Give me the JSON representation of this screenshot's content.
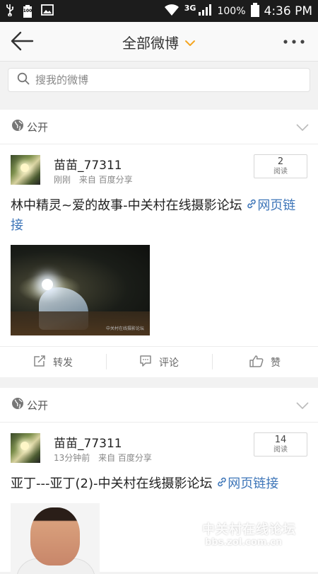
{
  "status_bar": {
    "battery_small": "100",
    "network": "3G",
    "battery_percent": "100%",
    "time": "4:36 PM",
    "icons": [
      "usb-icon",
      "battery-small-icon",
      "image-icon",
      "wifi-icon",
      "signal-icon",
      "battery-icon"
    ]
  },
  "nav": {
    "title": "全部微博",
    "back_icon": "back-arrow-icon",
    "dropdown_icon": "chevron-down-icon",
    "more_icon": "more-icon",
    "accent_color": "#f5a623"
  },
  "search": {
    "placeholder": "搜我的微博"
  },
  "posts": [
    {
      "privacy": "公开",
      "username": "苗苗_77311",
      "time": "刚刚",
      "source": "来自 百度分享",
      "read_count": "2",
      "read_label": "阅读",
      "text": "林中精灵~爱的故事-中关村在线摄影论坛",
      "link_text": "网页链接",
      "image_watermark": "中关村在线摄影论坛",
      "actions": [
        "转发",
        "评论",
        "赞"
      ]
    },
    {
      "privacy": "公开",
      "username": "苗苗_77311",
      "time": "13分钟前",
      "source": "来自 百度分享",
      "read_count": "14",
      "read_label": "阅读",
      "text": "亚丁---亚丁(2)-中关村在线摄影论坛",
      "link_text": "网页链接"
    }
  ],
  "watermark": {
    "name": "中关村在线论坛",
    "url": "bbs.zol.com.cn"
  },
  "colors": {
    "link": "#3d75b8",
    "status_bar": "#1c1c1c"
  }
}
